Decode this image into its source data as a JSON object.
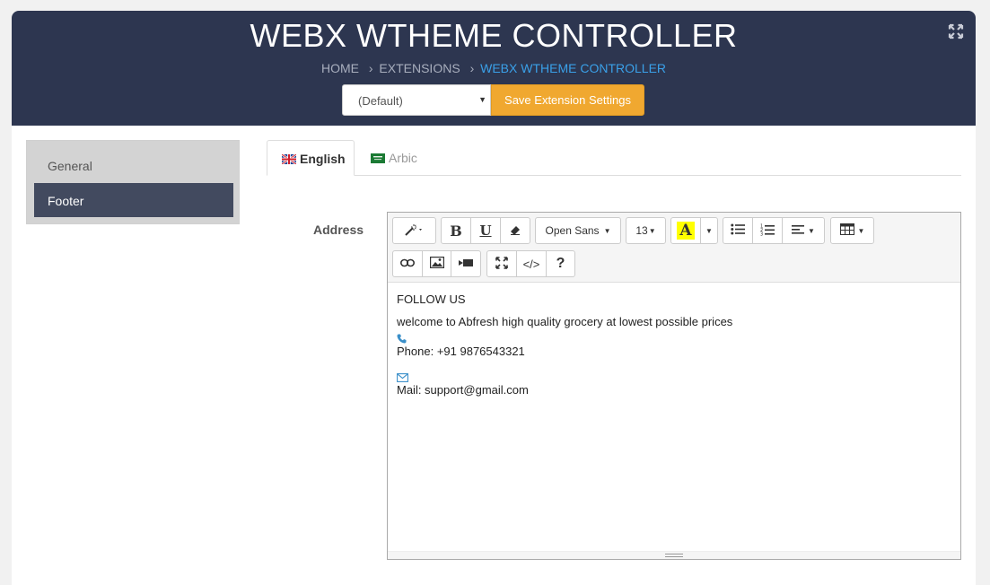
{
  "header": {
    "title": "WEBX WTHEME CONTROLLER",
    "breadcrumb": [
      {
        "label": "HOME"
      },
      {
        "label": "EXTENSIONS"
      },
      {
        "label": "WEBX WTHEME CONTROLLER"
      }
    ],
    "store_select": {
      "value": "(Default)"
    },
    "save_label": "Save Extension Settings"
  },
  "sidebar": {
    "items": [
      {
        "label": "General",
        "active": false
      },
      {
        "label": "Footer",
        "active": true
      }
    ]
  },
  "tabs": [
    {
      "label": "English",
      "active": true
    },
    {
      "label": "Arbic",
      "active": false
    }
  ],
  "form": {
    "address_label": "Address"
  },
  "editor": {
    "toolbar": {
      "font_family": "Open Sans",
      "font_size": "13",
      "color_letter": "A"
    },
    "content": {
      "heading": "FOLLOW US",
      "welcome": "welcome to Abfresh high quality grocery at lowest possible prices",
      "phone": "Phone: +91 9876543321",
      "mail": "Mail: support@gmail.com"
    }
  },
  "colors": {
    "header_bg": "#2d3650",
    "accent_orange": "#f0a830",
    "breadcrumb_active": "#3aa0e8",
    "sidebar_active": "#424a5f"
  }
}
